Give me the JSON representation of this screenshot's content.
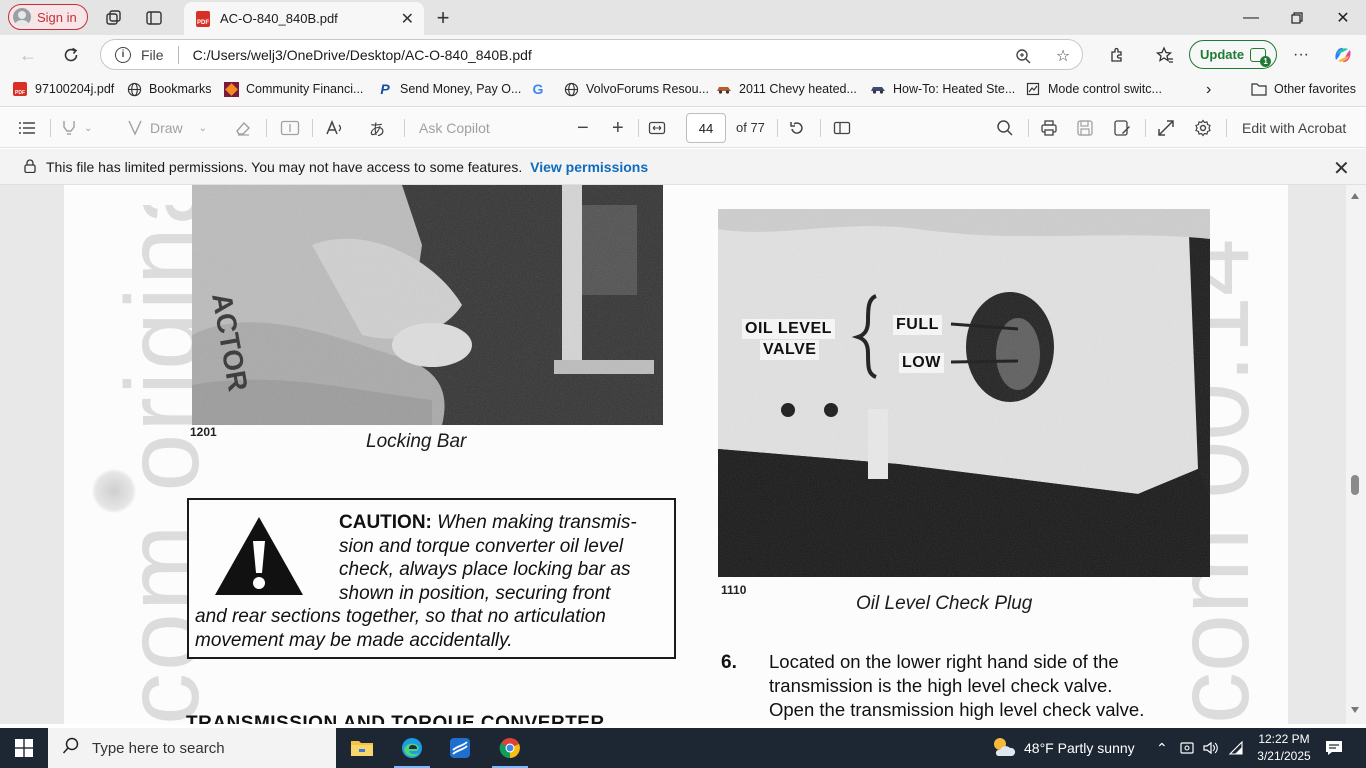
{
  "browser": {
    "signin_label": "Sign in",
    "tab_title": "AC-O-840_840B.pdf",
    "address_prefix": "File",
    "url": "C:/Users/welj3/OneDrive/Desktop/AC-O-840_840B.pdf",
    "update_label": "Update"
  },
  "bookmarks": [
    {
      "label": "97100204j.pdf",
      "icon": "pdf-icon"
    },
    {
      "label": "Bookmarks",
      "icon": "globe-icon"
    },
    {
      "label": "Community Financi...",
      "icon": "community-financial-icon"
    },
    {
      "label": "Send Money, Pay O...",
      "icon": "paypal-icon"
    },
    {
      "label": "",
      "icon": "google-icon"
    },
    {
      "label": "VolvoForums Resou...",
      "icon": "globe-icon"
    },
    {
      "label": "2011 Chevy heated...",
      "icon": "car-icon"
    },
    {
      "label": "How-To: Heated Ste...",
      "icon": "car-icon"
    },
    {
      "label": "Mode control switc...",
      "icon": "page-icon"
    }
  ],
  "other_favorites": "Other favorites",
  "pdf_toolbar": {
    "draw_label": "Draw",
    "ask_copilot_label": "Ask Copilot",
    "current_page": "44",
    "page_total": "of 77",
    "edit_acrobat_label": "Edit with Acrobat"
  },
  "permissions": {
    "message": "This file has limited permissions. You may not have access to some features.",
    "link": "View permissions"
  },
  "document": {
    "fig_left_number": "1201",
    "fig_left_caption": "Locking Bar",
    "fig_right_number": "1110",
    "fig_right_caption": "Oil Level Check Plug",
    "photo_label_oil_level_1": "OIL LEVEL",
    "photo_label_oil_level_2": "VALVE",
    "photo_label_full": "FULL",
    "photo_label_low": "LOW",
    "caution_keyword": "CAUTION:",
    "caution_lines": [
      "When making transmis-",
      "sion and torque converter oil level",
      "check, always place locking bar as",
      "shown in position, securing front",
      "and rear sections together, so that no articulation",
      "movement may be made accidentally."
    ],
    "step_number": "6.",
    "step_lines": [
      "Located on the lower right hand side of the",
      "transmission is the high level check valve.",
      "Open the transmission high level check valve."
    ],
    "section_heading": "TRANSMISSION AND TORQUE CONVERTER",
    "watermark_left": "com original b",
    "watermark_right": "com 00.14"
  },
  "taskbar": {
    "search_placeholder": "Type here to search",
    "weather": "48°F  Partly sunny",
    "time": "12:22 PM",
    "date": "3/21/2025"
  },
  "colors": {
    "accent_red": "#c2303a",
    "link_blue": "#0f6cbd",
    "update_green": "#1e7b34",
    "taskbar": "#1c2733"
  }
}
